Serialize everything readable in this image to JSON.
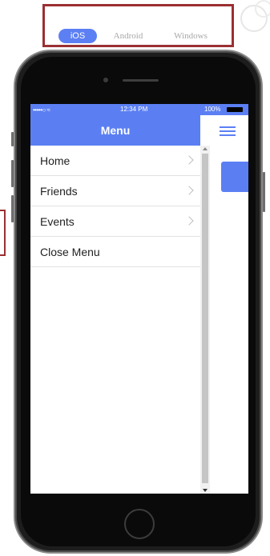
{
  "platform_tabs": [
    {
      "label": "iOS",
      "active": true
    },
    {
      "label": "Android",
      "active": false
    },
    {
      "label": "Windows",
      "active": false
    }
  ],
  "status_bar": {
    "carrier": "•••••○ ≈",
    "time": "12:34 PM",
    "battery": "100%"
  },
  "menu": {
    "title": "Menu",
    "items": [
      {
        "label": "Home",
        "has_chevron": true
      },
      {
        "label": "Friends",
        "has_chevron": true
      },
      {
        "label": "Events",
        "has_chevron": true
      },
      {
        "label": "Close Menu",
        "has_chevron": false
      }
    ]
  },
  "colors": {
    "accent": "#5b7ff3",
    "highlight_border": "#9b2f32",
    "phone_body": "#1d1d1d"
  },
  "icons": [
    "hamburger-icon",
    "chevron-right-icon",
    "battery-icon",
    "home-button"
  ]
}
